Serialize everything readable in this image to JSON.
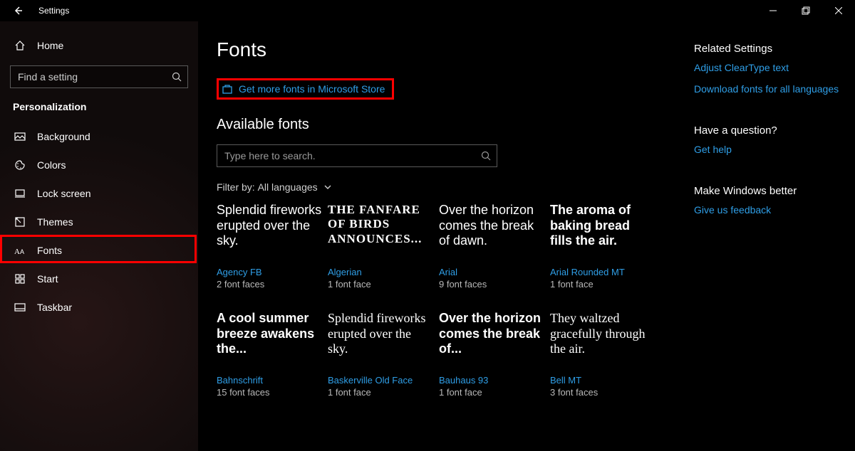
{
  "titlebar": {
    "title": "Settings"
  },
  "sidebar": {
    "home": "Home",
    "search_placeholder": "Find a setting",
    "section": "Personalization",
    "items": [
      {
        "label": "Background"
      },
      {
        "label": "Colors"
      },
      {
        "label": "Lock screen"
      },
      {
        "label": "Themes"
      },
      {
        "label": "Fonts"
      },
      {
        "label": "Start"
      },
      {
        "label": "Taskbar"
      }
    ]
  },
  "page": {
    "title": "Fonts",
    "store_link": "Get more fonts in Microsoft Store",
    "available": "Available fonts",
    "search_placeholder": "Type here to search.",
    "filter_label": "Filter by:",
    "filter_value": "All languages"
  },
  "fonts": [
    {
      "preview": "Splendid fireworks erupted over the sky.",
      "name": "Agency FB",
      "faces": "2 font faces",
      "cls": "f-agency"
    },
    {
      "preview": "THE FANFARE OF BIRDS ANNOUNCES...",
      "name": "Algerian",
      "faces": "1 font face",
      "cls": "f-algerian"
    },
    {
      "preview": "Over the horizon comes the break of dawn.",
      "name": "Arial",
      "faces": "9 font faces",
      "cls": "f-arial"
    },
    {
      "preview": "The aroma of baking bread fills the air.",
      "name": "Arial Rounded MT",
      "faces": "1 font face",
      "cls": "f-arialround"
    },
    {
      "preview": "A cool summer breeze awakens the...",
      "name": "Bahnschrift",
      "faces": "15 font faces",
      "cls": "f-bahn"
    },
    {
      "preview": "Splendid fireworks erupted over the sky.",
      "name": "Baskerville Old Face",
      "faces": "1 font face",
      "cls": "f-basker"
    },
    {
      "preview": "Over the horizon comes the break of...",
      "name": "Bauhaus 93",
      "faces": "1 font face",
      "cls": "f-bauhaus"
    },
    {
      "preview": "They waltzed gracefully through the air.",
      "name": "Bell MT",
      "faces": "3 font faces",
      "cls": "f-bell"
    }
  ],
  "aside": {
    "related_head": "Related Settings",
    "related_links": [
      "Adjust ClearType text",
      "Download fonts for all languages"
    ],
    "question_head": "Have a question?",
    "question_link": "Get help",
    "feedback_head": "Make Windows better",
    "feedback_link": "Give us feedback"
  }
}
